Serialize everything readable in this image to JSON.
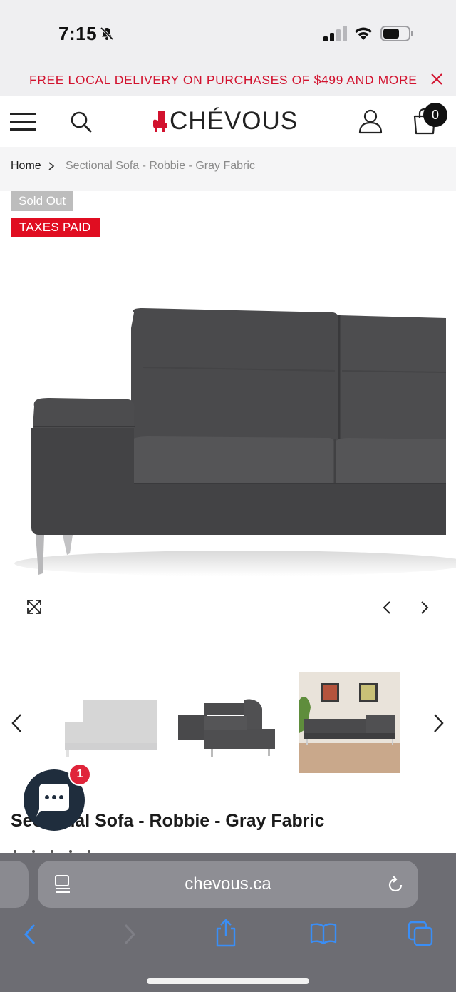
{
  "status_bar": {
    "time": "7:15"
  },
  "promo": {
    "text": "FREE LOCAL DELIVERY ON PURCHASES OF $499 AND MORE",
    "color": "#d2122e"
  },
  "header": {
    "logo_text": "CHÉVOUS",
    "cart_count": "0"
  },
  "breadcrumb": {
    "home": "Home",
    "current": "Sectional Sofa - Robbie - Gray Fabric"
  },
  "badges": {
    "sold_out": "Sold Out",
    "taxes_paid": "TAXES PAID",
    "taxes_color": "#e00d21"
  },
  "product": {
    "title": "Sectional Sofa - Robbie - Gray Fabric"
  },
  "chat": {
    "unread": "1"
  },
  "browser": {
    "url": "chevous.ca"
  }
}
